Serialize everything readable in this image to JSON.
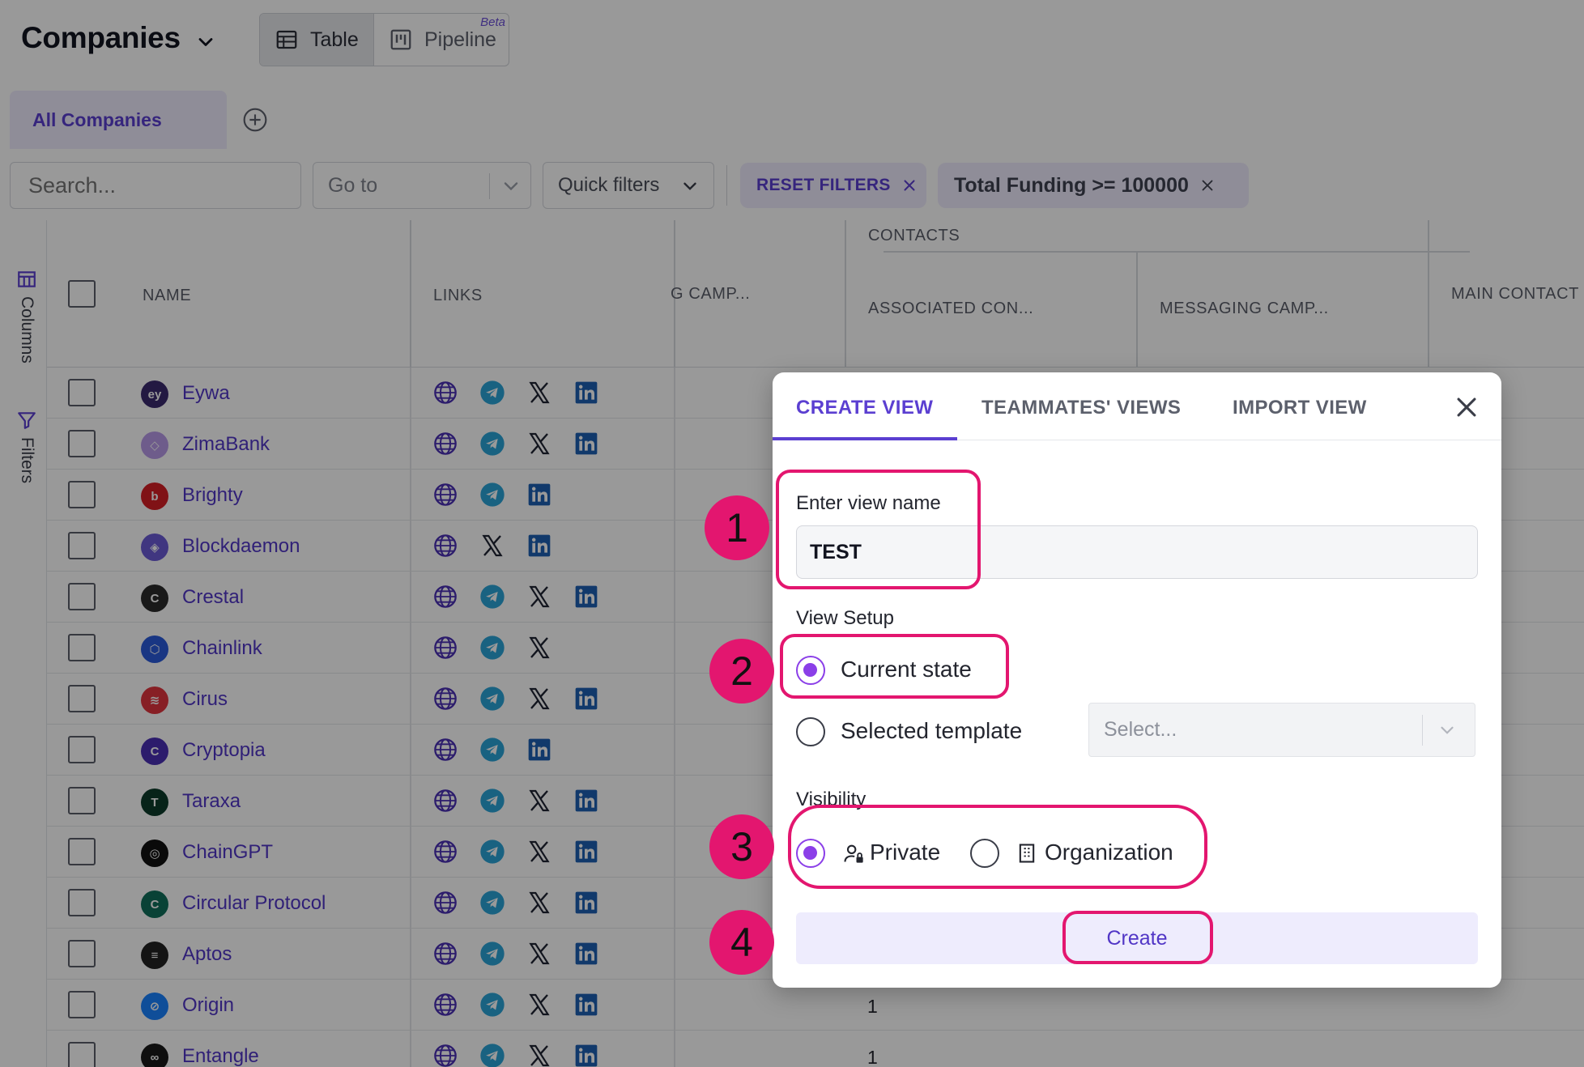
{
  "header": {
    "title": "Companies",
    "views": [
      {
        "label": "Table",
        "active": true
      },
      {
        "label": "Pipeline",
        "active": false,
        "badge": "Beta"
      }
    ]
  },
  "tabs": {
    "active_label": "All Companies"
  },
  "filters": {
    "search_placeholder": "Search...",
    "goto_placeholder": "Go to",
    "quick_filters_label": "Quick filters",
    "reset_label": "RESET FILTERS",
    "active_filter": "Total Funding >= 100000"
  },
  "side_rail": {
    "columns_label": "Columns",
    "filters_label": "Filters"
  },
  "table": {
    "headers": {
      "name": "NAME",
      "links": "LINKS",
      "campaigns": "G CAMP...",
      "group_contacts": "CONTACTS",
      "associated": "ASSOCIATED CON...",
      "messaging": "MESSAGING CAMP...",
      "main_contact": "MAIN CONTACT"
    },
    "rows": [
      {
        "name": "Eywa",
        "logo_color": "#3b2a6e",
        "logo_text": "ey",
        "links": [
          "globe",
          "telegram",
          "x",
          "linkedin"
        ],
        "value": ""
      },
      {
        "name": "ZimaBank",
        "logo_color": "#b79ae8",
        "logo_text": "◇",
        "links": [
          "globe",
          "telegram",
          "x",
          "linkedin"
        ],
        "value": ""
      },
      {
        "name": "Brighty",
        "logo_color": "#d61f26",
        "logo_text": "b",
        "links": [
          "globe",
          "telegram",
          "linkedin"
        ],
        "value": ""
      },
      {
        "name": "Blockdaemon",
        "logo_color": "#6b5bd6",
        "logo_text": "◈",
        "links": [
          "globe",
          "x",
          "linkedin"
        ],
        "value": ""
      },
      {
        "name": "Crestal",
        "logo_color": "#2b2b2b",
        "logo_text": "C",
        "links": [
          "globe",
          "telegram",
          "x",
          "linkedin"
        ],
        "value": ""
      },
      {
        "name": "Chainlink",
        "logo_color": "#2a5ada",
        "logo_text": "⬡",
        "links": [
          "globe",
          "telegram",
          "x"
        ],
        "value": ""
      },
      {
        "name": "Cirus",
        "logo_color": "#e2343e",
        "logo_text": "≋",
        "links": [
          "globe",
          "telegram",
          "x",
          "linkedin"
        ],
        "value": ""
      },
      {
        "name": "Cryptopia",
        "logo_color": "#4a2fb5",
        "logo_text": "C",
        "links": [
          "globe",
          "telegram",
          "linkedin"
        ],
        "value": ""
      },
      {
        "name": "Taraxa",
        "logo_color": "#0d3b2b",
        "logo_text": "T",
        "links": [
          "globe",
          "telegram",
          "x",
          "linkedin"
        ],
        "value": ""
      },
      {
        "name": "ChainGPT",
        "logo_color": "#111111",
        "logo_text": "◎",
        "links": [
          "globe",
          "telegram",
          "x",
          "linkedin"
        ],
        "value": ""
      },
      {
        "name": "Circular Protocol",
        "logo_color": "#0f6e5a",
        "logo_text": "C",
        "links": [
          "globe",
          "telegram",
          "x",
          "linkedin"
        ],
        "value": ""
      },
      {
        "name": "Aptos",
        "logo_color": "#222222",
        "logo_text": "≡",
        "links": [
          "globe",
          "telegram",
          "x",
          "linkedin"
        ],
        "value": ""
      },
      {
        "name": "Origin",
        "logo_color": "#1a82ff",
        "logo_text": "⊘",
        "links": [
          "globe",
          "telegram",
          "x",
          "linkedin"
        ],
        "value": "1"
      },
      {
        "name": "Entangle",
        "logo_color": "#1a1a1a",
        "logo_text": "∞",
        "links": [
          "globe",
          "telegram",
          "x",
          "linkedin"
        ],
        "value": "1"
      }
    ]
  },
  "modal": {
    "tabs": [
      "CREATE VIEW",
      "TEAMMATES' VIEWS",
      "IMPORT VIEW"
    ],
    "active_tab": "CREATE VIEW",
    "name_label": "Enter view name",
    "name_value": "TEST",
    "setup_label": "View Setup",
    "setup_options": [
      {
        "label": "Current state",
        "selected": true
      },
      {
        "label": "Selected template",
        "selected": false
      }
    ],
    "template_placeholder": "Select...",
    "visibility_label": "Visibility",
    "visibility_options": [
      {
        "label": "Private",
        "selected": true,
        "icon": "user-lock-icon"
      },
      {
        "label": "Organization",
        "selected": false,
        "icon": "building-icon"
      }
    ],
    "create_label": "Create"
  },
  "annotations": [
    "1",
    "2",
    "3",
    "4"
  ],
  "colors": {
    "accent": "#5b3fd1",
    "radio": "#8b3fe8",
    "annotation": "#e3166f",
    "overlay": "rgba(0,0,0,0.40)"
  }
}
